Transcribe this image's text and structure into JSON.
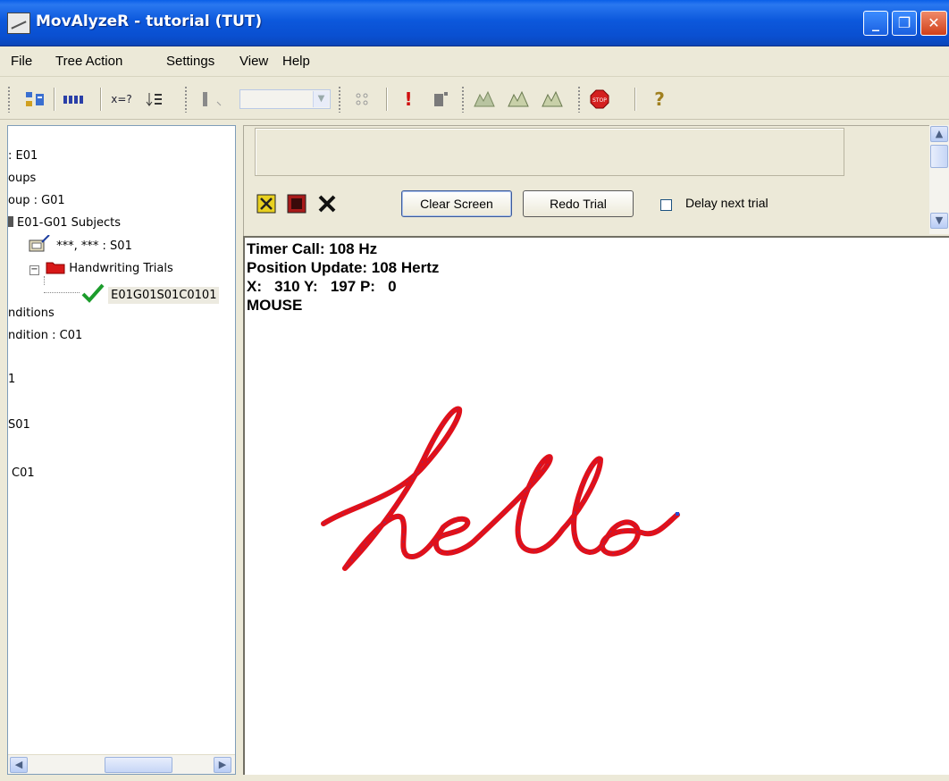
{
  "window": {
    "title": "MovAlyzeR - tutorial (TUT)",
    "min_glyph": "_",
    "max_glyph": "❐",
    "close_glyph": "✕"
  },
  "menu": [
    "File",
    "Tree Action",
    "Settings",
    "View",
    "Help"
  ],
  "toolbar": {
    "formula_label": "x=?",
    "help_glyph": "?"
  },
  "tree": {
    "nodes": [
      ": E01",
      "oups",
      "oup : G01",
      "E01-G01 Subjects",
      "***, *** : S01",
      "Handwriting Trials",
      "E01G01S01C0101",
      "nditions",
      "ndition : C01",
      "1",
      "S01",
      "C01"
    ],
    "expander": "−"
  },
  "controls": {
    "clear_label": "Clear Screen",
    "redo_label": "Redo Trial",
    "delay_label": "Delay next trial",
    "delay_checked": false
  },
  "canvas": {
    "lines": [
      "Timer Call: 108 Hz",
      "Position Update: 108 Hertz",
      "X:   310 Y:   197 P:   0",
      "MOUSE"
    ],
    "stroke_color": "#e0101a"
  },
  "colors": {
    "title_bar": "#0a52d8",
    "ink": "#e0101a"
  }
}
